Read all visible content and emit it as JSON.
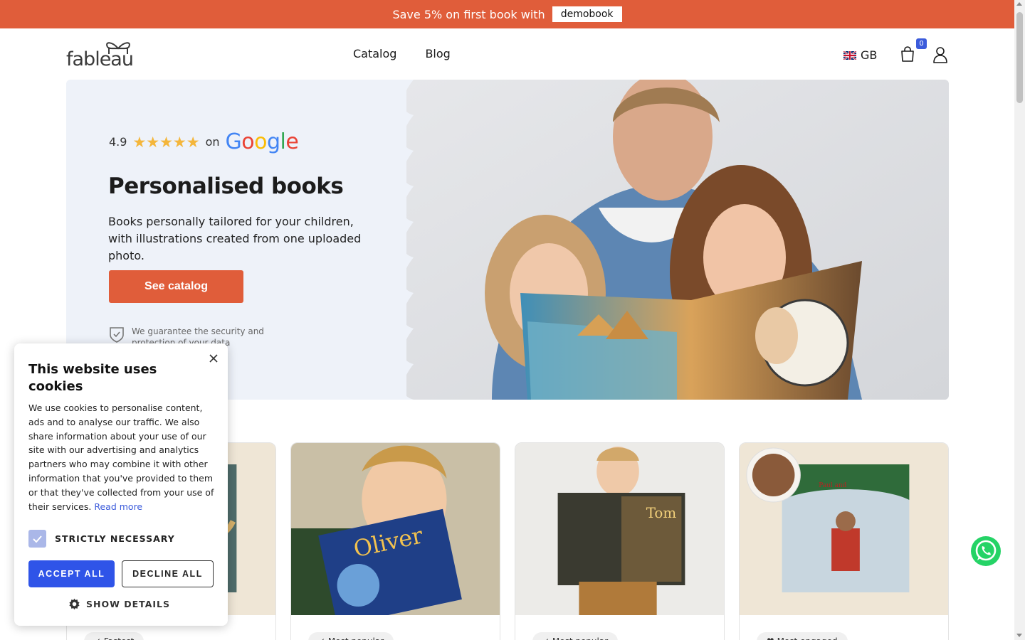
{
  "promo": {
    "text": "Save 5% on first book with",
    "code": "demobook",
    "color": "#e05d3a"
  },
  "header": {
    "logo_text": "fableau",
    "nav": [
      "Catalog",
      "Blog"
    ],
    "language": "GB",
    "cart_count": "0"
  },
  "hero": {
    "rating_value": "4.9",
    "stars": "★★★★★",
    "rating_on": "on",
    "rating_source": "Google",
    "title": "Personalised books",
    "description": "Books personally tailored for your children, with illustrations created from one uploaded photo.",
    "cta_label": "See catalog",
    "guarantee": "We guarantee the security and protection of your data"
  },
  "cookie_banner": {
    "title": "This website uses cookies",
    "body": "We use cookies to personalise content, ads and to analyse our traffic. We also share information about your use of our site with our advertising and analytics partners who may combine it with other information that you've provided to them or that they've collected from your use of their services.",
    "read_more": "Read more",
    "strictly_necessary": "STRICTLY NECESSARY",
    "accept_all": "ACCEPT ALL",
    "decline_all": "DECLINE ALL",
    "show_details": "SHOW DETAILS"
  },
  "cards": [
    {
      "tag": "✓ Fastest"
    },
    {
      "tag": "✓ Most popular"
    },
    {
      "tag": "✓ Most popular"
    },
    {
      "tag": "♥ Most engaged"
    }
  ],
  "colors": {
    "accent": "#e05d3a",
    "primary_button": "#2f54e8",
    "hero_bg": "#eef2f9",
    "star": "#f4b63b",
    "badge": "#3b5bdb"
  }
}
